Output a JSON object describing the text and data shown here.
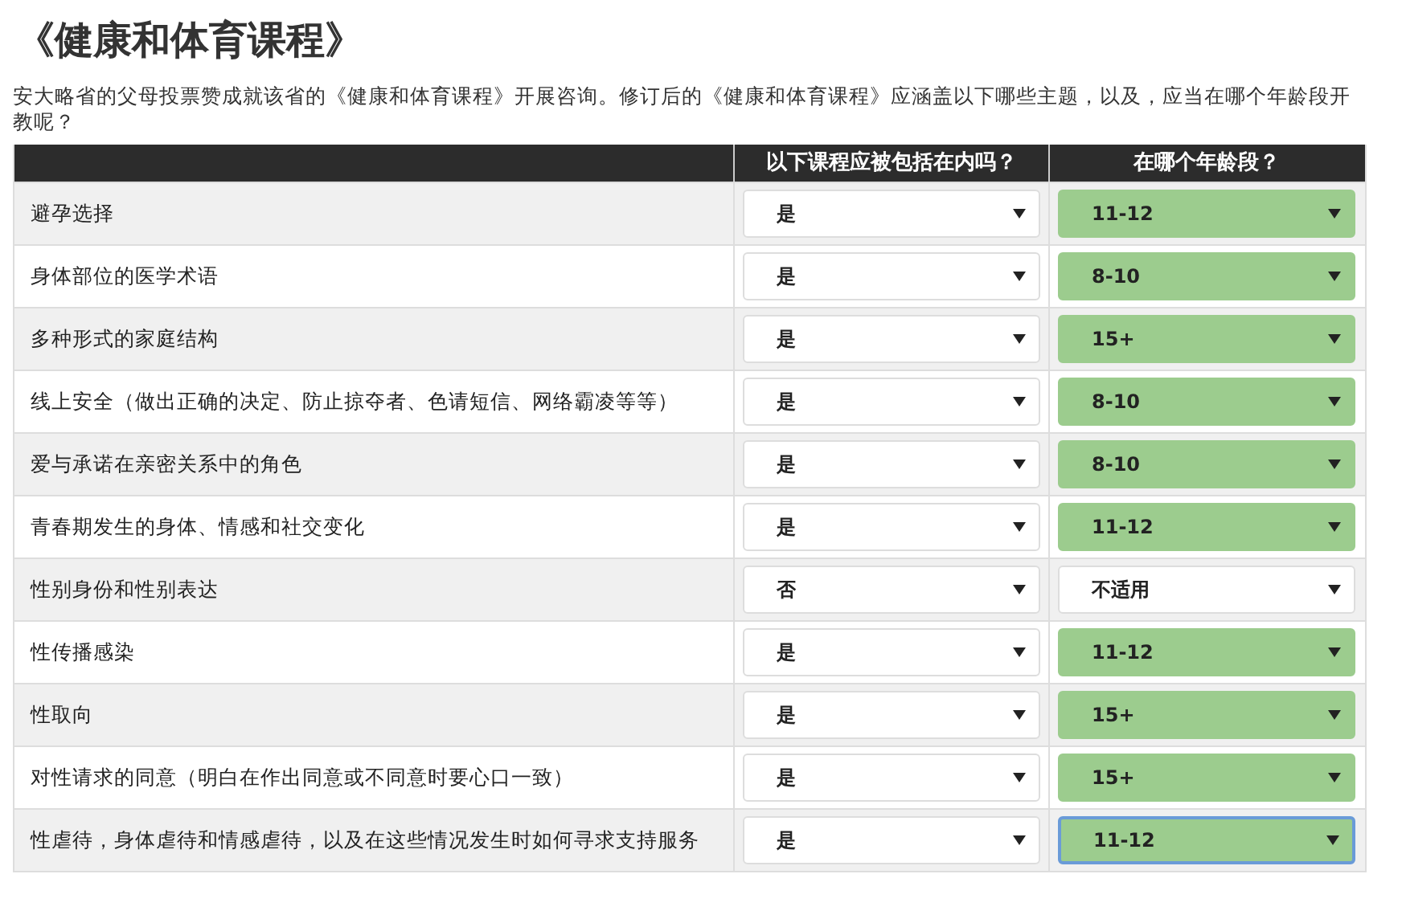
{
  "title": "《健康和体育课程》",
  "intro_lines": [
    "安大略省的父母投票赞成就该省的《健康和体育课程》开展咨询。修订后的《健康和体育课程》应涵盖以下哪些主题，以及，应当在哪个年龄段开",
    "教呢？"
  ],
  "table": {
    "columns": [
      "以下课程应被包括在内吗？",
      "在哪个年龄段？"
    ],
    "rows": [
      {
        "topic": "避孕选择",
        "include": "是",
        "age": "11-12",
        "answered": true,
        "focused": false
      },
      {
        "topic": "身体部位的医学术语",
        "include": "是",
        "age": "8-10",
        "answered": true,
        "focused": false
      },
      {
        "topic": "多种形式的家庭结构",
        "include": "是",
        "age": "15+",
        "answered": true,
        "focused": false
      },
      {
        "topic": "线上安全（做出正确的决定、防止掠夺者、色请短信、网络霸凌等等）",
        "include": "是",
        "age": "8-10",
        "answered": true,
        "focused": false
      },
      {
        "topic": "爱与承诺在亲密关系中的角色",
        "include": "是",
        "age": "8-10",
        "answered": true,
        "focused": false
      },
      {
        "topic": "青春期发生的身体、情感和社交变化",
        "include": "是",
        "age": "11-12",
        "answered": true,
        "focused": false
      },
      {
        "topic": "性别身份和性别表达",
        "include": "否",
        "age": "不适用",
        "answered": false,
        "focused": false
      },
      {
        "topic": "性传播感染",
        "include": "是",
        "age": "11-12",
        "answered": true,
        "focused": false
      },
      {
        "topic": "性取向",
        "include": "是",
        "age": "15+",
        "answered": true,
        "focused": false
      },
      {
        "topic": "对性请求的同意（明白在作出同意或不同意时要心口一致）",
        "include": "是",
        "age": "15+",
        "answered": true,
        "focused": false
      },
      {
        "topic": "性虐待，身体虐待和情感虐待，以及在这些情况发生时如何寻求支持服务",
        "include": "是",
        "age": "11-12",
        "answered": true,
        "focused": true
      }
    ]
  }
}
